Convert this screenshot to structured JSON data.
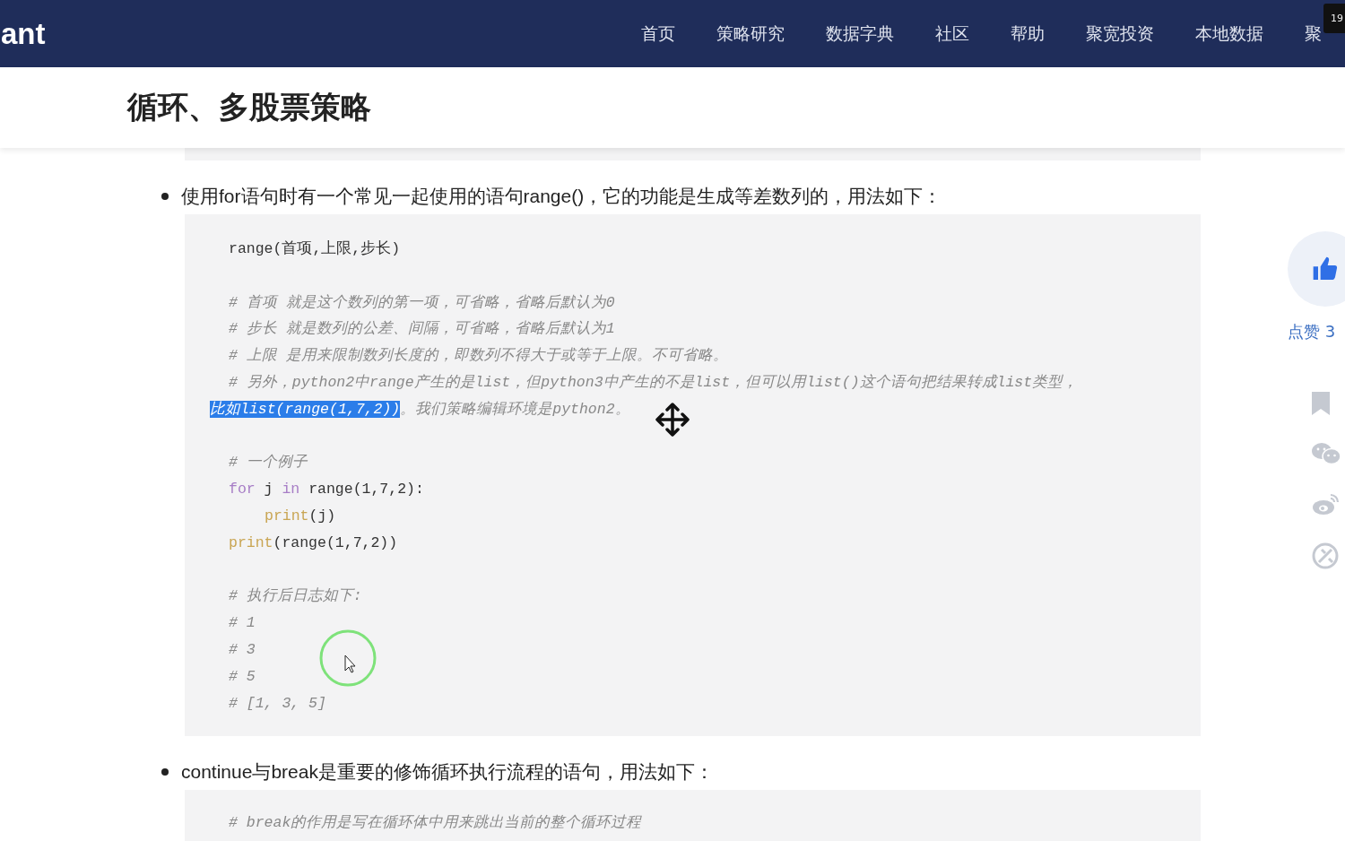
{
  "header": {
    "logo": "ant",
    "nav": [
      {
        "label": "首页"
      },
      {
        "label": "策略研究"
      },
      {
        "label": "数据字典"
      },
      {
        "label": "社区"
      },
      {
        "label": "帮助"
      },
      {
        "label": "聚宽投资"
      },
      {
        "label": "本地数据"
      },
      {
        "label": "聚"
      }
    ],
    "tooltip": "19"
  },
  "title": "循环、多股票策略",
  "sections": [
    {
      "text": "使用for语句时有一个常见一起使用的语句range()，它的功能是生成等差数列的，用法如下：",
      "code": [
        {
          "kind": "code",
          "tokens": [
            {
              "text": "range(首项,上限,步长)",
              "kind": "plain"
            }
          ]
        },
        {
          "kind": "blank"
        },
        {
          "kind": "code",
          "tokens": [
            {
              "text": "# 首项 就是这个数列的第一项，可省略，省略后默认为0",
              "kind": "comment"
            }
          ]
        },
        {
          "kind": "code",
          "tokens": [
            {
              "text": "# 步长 就是数列的公差、间隔，可省略，省略后默认为1",
              "kind": "comment"
            }
          ]
        },
        {
          "kind": "code",
          "tokens": [
            {
              "text": "# 上限 是用来限制数列长度的，即数列不得大于或等于上限。不可省略。",
              "kind": "comment"
            }
          ]
        },
        {
          "kind": "code",
          "tokens": [
            {
              "text": "# 另外，python2中range产生的是list，但python3中产生的不是list，但可以用list()这个语句把结果转成list类型，",
              "kind": "comment"
            }
          ]
        },
        {
          "kind": "wrapped",
          "tokens": [
            {
              "text": "比如list(range(1,7,2))",
              "kind": "selected"
            },
            {
              "text": "。我们策略编辑环境是python2。",
              "kind": "comment"
            }
          ]
        },
        {
          "kind": "blank"
        },
        {
          "kind": "code",
          "tokens": [
            {
              "text": "# 一个例子",
              "kind": "comment"
            }
          ]
        },
        {
          "kind": "code",
          "tokens": [
            {
              "text": "for",
              "kind": "keyword"
            },
            {
              "text": " j ",
              "kind": "plain"
            },
            {
              "text": "in",
              "kind": "keyword"
            },
            {
              "text": " range(1,7,2):",
              "kind": "plain"
            }
          ]
        },
        {
          "kind": "nested",
          "tokens": [
            {
              "text": "print",
              "kind": "builtin"
            },
            {
              "text": "(j)",
              "kind": "plain"
            }
          ]
        },
        {
          "kind": "code",
          "tokens": [
            {
              "text": "print",
              "kind": "builtin"
            },
            {
              "text": "(range(1,7,2))",
              "kind": "plain"
            }
          ]
        },
        {
          "kind": "blank"
        },
        {
          "kind": "code",
          "tokens": [
            {
              "text": "# 执行后日志如下:",
              "kind": "comment"
            }
          ]
        },
        {
          "kind": "code",
          "tokens": [
            {
              "text": "# 1",
              "kind": "comment"
            }
          ]
        },
        {
          "kind": "code",
          "tokens": [
            {
              "text": "# 3",
              "kind": "comment"
            }
          ]
        },
        {
          "kind": "code",
          "tokens": [
            {
              "text": "# 5",
              "kind": "comment"
            }
          ]
        },
        {
          "kind": "code",
          "tokens": [
            {
              "text": "# [1, 3, 5]",
              "kind": "comment"
            }
          ]
        }
      ]
    },
    {
      "text": "continue与break是重要的修饰循环执行流程的语句，用法如下：",
      "code": [
        {
          "kind": "code",
          "tokens": [
            {
              "text": "# break的作用是写在循环体中用来跳出当前的整个循环过程",
              "kind": "comment"
            }
          ]
        }
      ]
    }
  ],
  "side": {
    "like_label": "点赞 3"
  }
}
